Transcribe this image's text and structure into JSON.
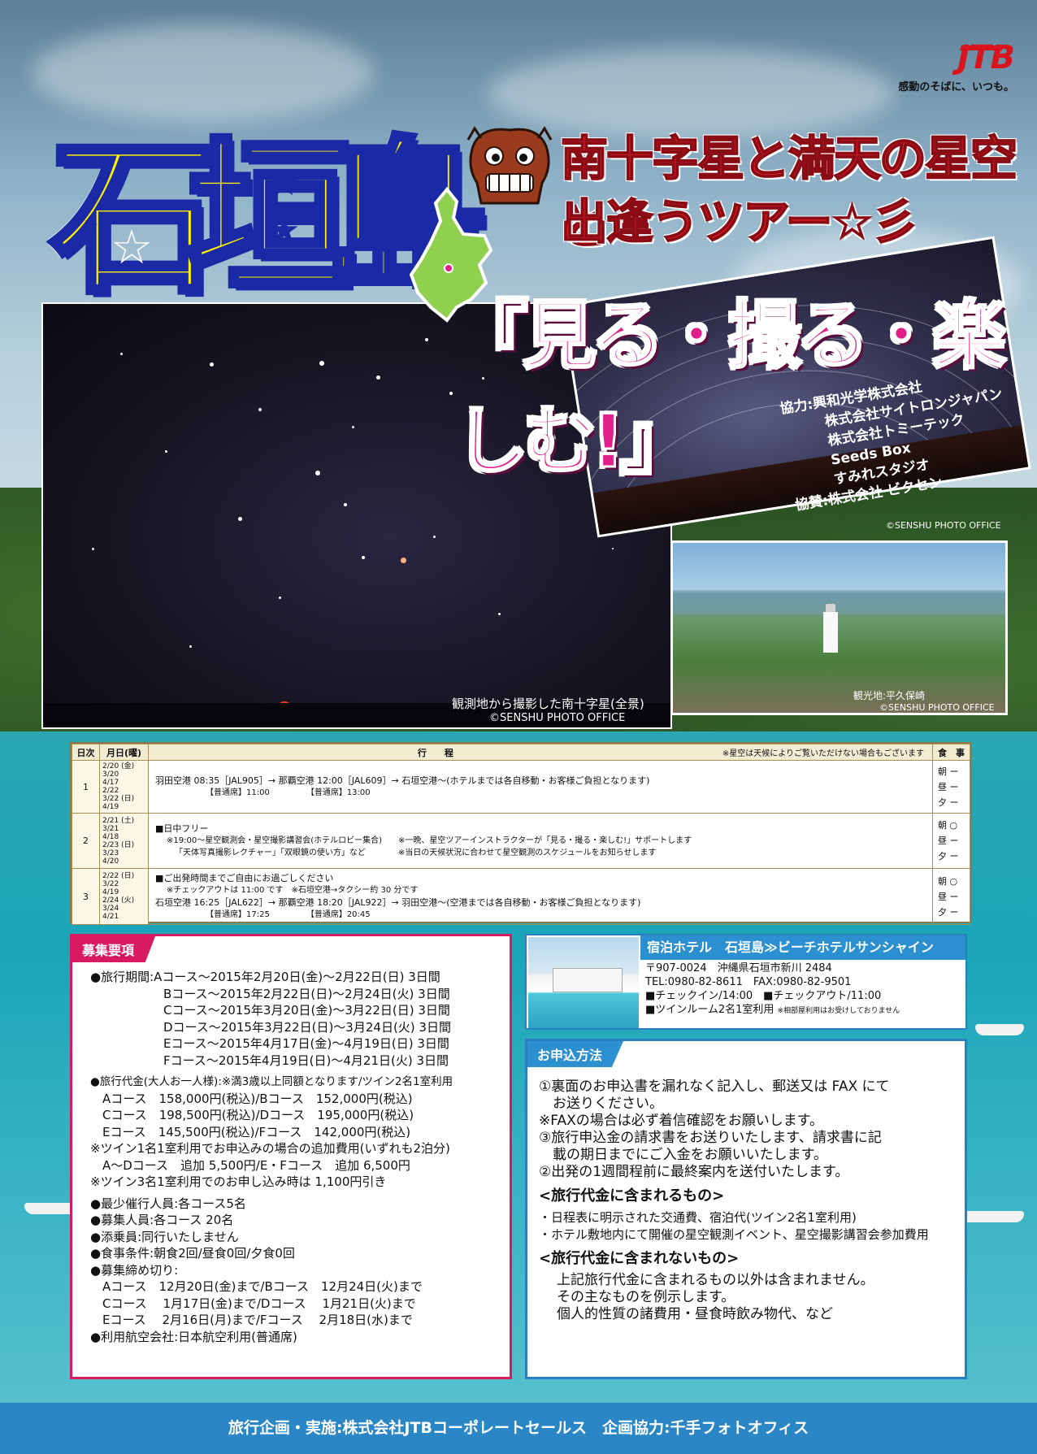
{
  "brand": {
    "logo": "JTB",
    "tagline": "感動のそばに、いつも。",
    "brand_color": "#d8141c"
  },
  "title": {
    "main": "石垣島",
    "sub_line1": "南十字星と満天の星空と",
    "sub_line2": "出逢うツアー☆彡",
    "catch": "『見る・撮る・楽しむ!』"
  },
  "photos": {
    "main_caption": "観測地から撮影した南十字星(全景)",
    "main_credit": "©SENSHU PHOTO OFFICE",
    "trail_credit": "©SENSHU PHOTO OFFICE",
    "cape_caption": "観光地:平久保崎",
    "cape_credit": "©SENSHU PHOTO OFFICE"
  },
  "cooperation": [
    "協力:興和光学株式会社",
    "株式会社サイトロンジャパン",
    "株式会社トミーテック",
    "Seeds Box",
    "すみれスタジオ",
    "協賛:株式会社 ビクセン"
  ],
  "itinerary": {
    "headers": {
      "day": "日次",
      "date": "月日(曜)",
      "plan": "行　　程",
      "note": "※星空は天候によりご覧いただけない場合もございます",
      "meal": "食　事"
    },
    "rows": [
      {
        "day": "1",
        "dates": [
          "2/20 (金)",
          "3/20",
          "4/17",
          "2/22",
          "3/22 (日)",
          "4/19"
        ],
        "plan": [
          "羽田空港 08:35［JAL905］→ 那覇空港 12:00［JAL609］→ 石垣空港～(ホテルまでは各自移動・お客様ご負担となります)",
          "【普通席】11:00　　　　　【普通席】13:00"
        ],
        "meals": [
          "朝 ー",
          "昼 ー",
          "夕 ー"
        ]
      },
      {
        "day": "2",
        "dates": [
          "2/21 (土)",
          "3/21",
          "4/18",
          "2/23 (日)",
          "3/23",
          "4/20"
        ],
        "plan": [
          "■日中フリー",
          "※19:00～星空観測会・星空撮影講習会(ホテルロビー集合)　　※一晩、星空ツアーインストラクターが「見る・撮る・楽しむ!」サポートします",
          "「天体写真撮影レクチャー」「双眼鏡の使い方」など　　　　※当日の天候状況に合わせて星空観測のスケジュールをお知らせします"
        ],
        "meals": [
          "朝 ○",
          "昼 ー",
          "夕 ー"
        ]
      },
      {
        "day": "3",
        "dates": [
          "2/22 (日)",
          "3/22",
          "4/19",
          "2/24 (火)",
          "3/24",
          "4/21"
        ],
        "plan": [
          "■ご出発時間までご自由にお過ごしください",
          "※チェックアウトは 11:00 です　※石垣空港→タクシー約 30 分です",
          "石垣空港 16:25［JAL622］→ 那覇空港 18:20［JAL922］→ 羽田空港～(空港までは各自移動・お客様ご負担となります)",
          "【普通席】17:25　　　　　【普通席】20:45"
        ],
        "meals": [
          "朝 ○",
          "昼 ー",
          "夕 ー"
        ]
      }
    ]
  },
  "recruit": {
    "title": "募集要項",
    "lines": [
      "●旅行期間:Aコース～2015年2月20日(金)～2月22日(日) 3日間",
      "　　　　　　Bコース～2015年2月22日(日)～2月24日(火) 3日間",
      "　　　　　　Cコース～2015年3月20日(金)～3月22日(日) 3日間",
      "　　　　　　Dコース～2015年3月22日(日)～3月24日(火) 3日間",
      "　　　　　　Eコース～2015年4月17日(金)～4月19日(日) 3日間",
      "　　　　　　Fコース～2015年4月19日(日)～4月21日(火) 3日間",
      "",
      "●旅行代金(大人お一人様):※満3歳以上同額となります/ツイン2名1室利用",
      "　Aコース　158,000円(税込)/Bコース　152,000円(税込)",
      "　Cコース　198,500円(税込)/Dコース　195,000円(税込)",
      "　Eコース　145,500円(税込)/Fコース　142,000円(税込)",
      "※ツイン1名1室利用でお申込みの場合の追加費用(いずれも2泊分)",
      "　A～Dコース　追加 5,500円/E・Fコース　追加 6,500円",
      "※ツイン3名1室利用でのお申し込み時は 1,100円引き",
      "",
      "●最少催行人員:各コース5名",
      "●募集人員:各コース 20名",
      "●添乗員:同行いたしません",
      "●食事条件:朝食2回/昼食0回/夕食0回",
      "●募集締め切り:",
      "　Aコース　12月20日(金)まで/Bコース　12月24日(火)まで",
      "　Cコース　 1月17日(金)まで/Dコース　 1月21日(火)まで",
      "　Eコース　 2月16日(月)まで/Fコース　 2月18日(水)まで",
      "●利用航空会社:日本航空利用(普通席)"
    ]
  },
  "hotel": {
    "title": "宿泊ホテル　石垣島≫ビーチホテルサンシャイン",
    "postal": "〒907-0024　沖縄県石垣市新川 2484",
    "tel": "TEL:0980-82-8611　FAX:0980-82-9501",
    "checkin": "■チェックイン/14:00　■チェックアウト/11:00",
    "room": "■ツインルーム2名1室利用",
    "room_note": "※相部屋利用はお受けしておりません"
  },
  "apply": {
    "title": "お申込方法",
    "steps": [
      "①裏面のお申込書を漏れなく記入し、郵送又は FAX にて",
      "　お送りください。",
      "※FAXの場合は必ず着信確認をお願いします。",
      "③旅行申込金の請求書をお送りいたします、請求書に記",
      "　載の期日までにご入金をお願いいたします。",
      "②出発の1週間程前に最終案内を送付いたします。"
    ],
    "included_head": "<旅行代金に含まれるもの>",
    "included": [
      "・日程表に明示された交通費、宿泊代(ツイン2名1室利用)",
      "・ホテル敷地内にて開催の星空観測イベント、星空撮影講習会参加費用"
    ],
    "excluded_head": "<旅行代金に含まれないもの>",
    "excluded": [
      "上記旅行代金に含まれるもの以外は含まれません。",
      "その主なものを例示します。",
      "個人的性質の諸費用・昼食時飲み物代、など"
    ]
  },
  "footer": "旅行企画・実施:株式会社JTBコーポレートセールス　企画協力:千手フォトオフィス"
}
